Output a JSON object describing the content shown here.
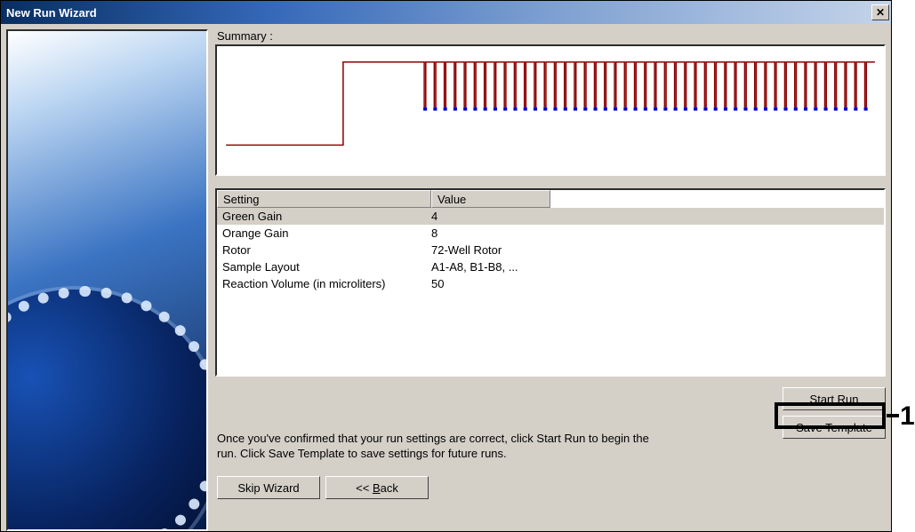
{
  "window": {
    "title": "New Run Wizard"
  },
  "summary_label": "Summary :",
  "table": {
    "headers": {
      "setting": "Setting",
      "value": "Value"
    },
    "rows": [
      {
        "setting": "Green Gain",
        "value": "4",
        "selected": true
      },
      {
        "setting": "Orange Gain",
        "value": "8",
        "selected": false
      },
      {
        "setting": "Rotor",
        "value": "72-Well Rotor",
        "selected": false
      },
      {
        "setting": "Sample Layout",
        "value": "A1-A8, B1-B8, ...",
        "selected": false
      },
      {
        "setting": "Reaction Volume (in microliters)",
        "value": "50",
        "selected": false
      }
    ]
  },
  "help_text": "Once you've confirmed that your run settings are correct, click Start Run to begin the run. Click Save Template to save settings for future runs.",
  "buttons": {
    "start_run": "Start Run",
    "start_run_accel": "S",
    "save_template": "Save Template",
    "skip_wizard": "Skip Wizard",
    "back": "<<  Back",
    "back_accel": "B"
  },
  "annotations": {
    "callout_1": "1"
  },
  "chart_data": {
    "type": "line",
    "title": "",
    "xlabel": "",
    "ylabel": "",
    "description": "PCR run profile: initial low hold, ramp to high plateau, then repeated cycling segments with brief acquisition points (blue markers) at low temperature",
    "initial_hold_level": 20,
    "plateau_level": 95,
    "cycle_low": 55,
    "cycle_high": 95,
    "cycle_count": 45,
    "acquisition_marker_color": "#0000cc",
    "profile_color": "#8b0000",
    "ylim": [
      0,
      100
    ]
  }
}
